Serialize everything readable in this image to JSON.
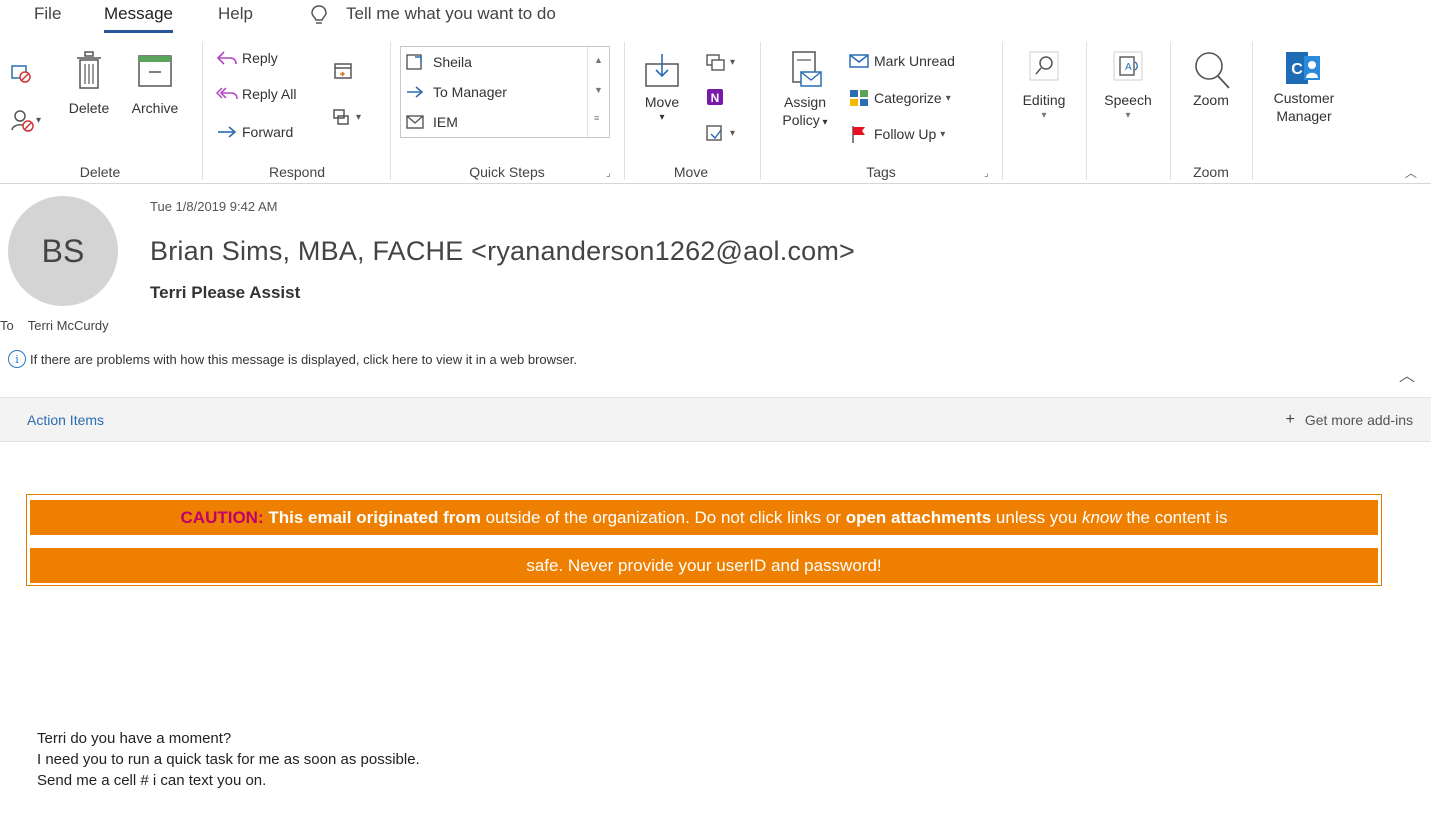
{
  "tabs": [
    {
      "label": "File",
      "active": false
    },
    {
      "label": "Message",
      "active": true
    },
    {
      "label": "Help",
      "active": false
    }
  ],
  "tell_me": {
    "placeholder": "Tell me what you want to do",
    "icon": "lightbulb-icon"
  },
  "ribbon": {
    "delete_group": {
      "label": "Delete",
      "delete": "Delete",
      "archive": "Archive"
    },
    "respond_group": {
      "label": "Respond",
      "reply": "Reply",
      "reply_all": "Reply All",
      "forward": "Forward"
    },
    "quick_steps_group": {
      "label": "Quick Steps",
      "items": [
        "Sheila",
        "To Manager",
        "IEM"
      ]
    },
    "move_group": {
      "label": "Move",
      "move": "Move"
    },
    "tags_group": {
      "label": "Tags",
      "assign_policy_line1": "Assign",
      "assign_policy_line2": "Policy",
      "mark_unread": "Mark Unread",
      "categorize": "Categorize",
      "follow_up": "Follow Up"
    },
    "editing": {
      "label": "Editing"
    },
    "speech": {
      "label": "Speech"
    },
    "zoom_group": {
      "label": "Zoom",
      "zoom": "Zoom"
    },
    "customer_manager": {
      "line1": "Customer",
      "line2": "Manager"
    }
  },
  "message": {
    "avatar_initials": "BS",
    "date": "Tue 1/8/2019 9:42 AM",
    "sender": "Brian Sims, MBA, FACHE <ryananderson1262@aol.com>",
    "subject": "Terri Please Assist",
    "to_label": "To",
    "to_value": "Terri McCurdy",
    "info_bar": "If there are problems with how this message is displayed, click here to view it in a web browser."
  },
  "action_bar": {
    "action_items": "Action Items",
    "get_addins": "Get more add-ins"
  },
  "caution": {
    "label": "CAUTION:",
    "line1_a": "This email originated",
    "line1_b": "from",
    "line1_c": "outside of the organization. Do not click links or",
    "line1_d": "open attachments",
    "line1_e": "unless you",
    "line1_f": "know",
    "line1_g": "the content is",
    "line2": "safe. Never provide your userID and password!"
  },
  "body_lines": [
    "Terri do you have a moment?",
    "I need you to run a quick task for me as soon as possible.",
    "Send me a cell # i can text you on."
  ],
  "colors": {
    "accent": "#2b579a",
    "caution_bg": "#ee7f00",
    "caution_label": "#c0006b",
    "link": "#2b6cb3",
    "avatar_bg": "#d4d4d4"
  }
}
